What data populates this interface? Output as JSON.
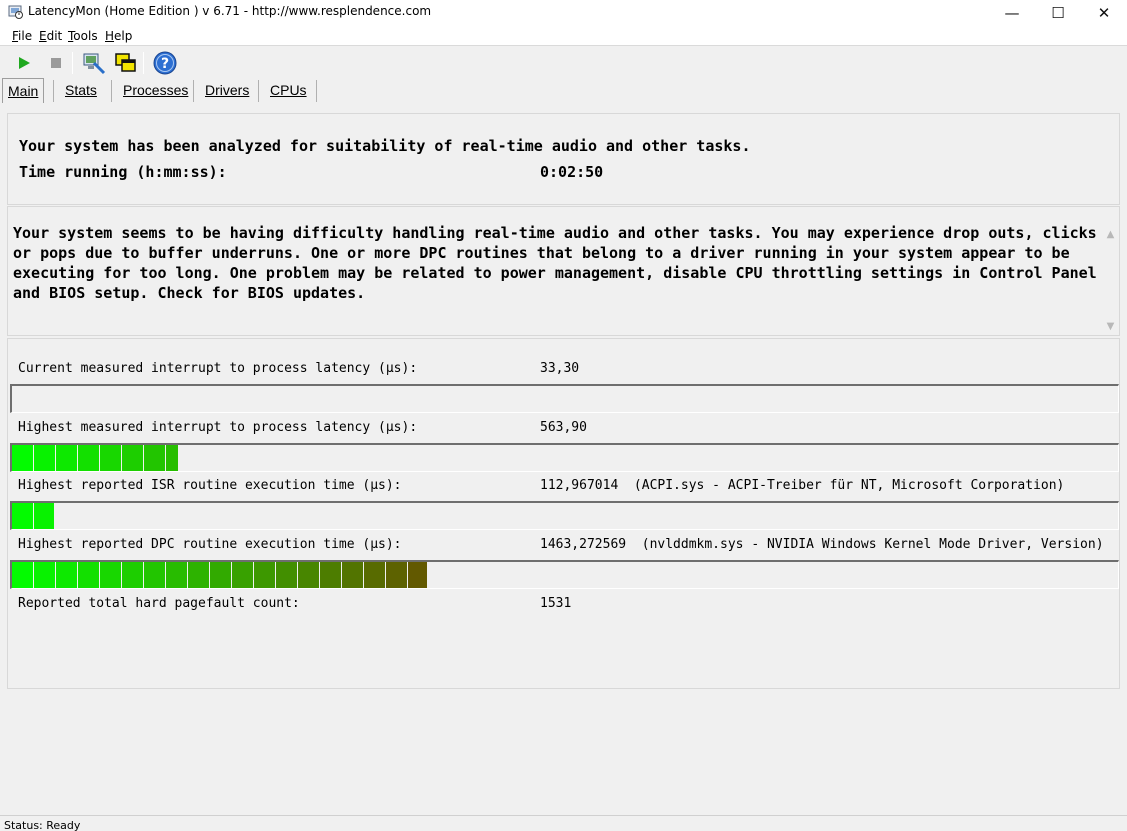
{
  "window": {
    "title": "LatencyMon  (Home Edition )  v 6.71 - http://www.resplendence.com",
    "minimize_glyph": "—",
    "maximize_glyph": "☐",
    "close_glyph": "✕"
  },
  "menu": [
    {
      "accel": "F",
      "rest": "ile"
    },
    {
      "accel": "E",
      "rest": "dit"
    },
    {
      "accel": "T",
      "rest": "ools"
    },
    {
      "accel": "H",
      "rest": "elp"
    }
  ],
  "toolbar": {
    "icons": [
      "play-icon",
      "stop-icon",
      "analyze-icon",
      "windows-icon",
      "help-icon"
    ]
  },
  "tabs": [
    "Main",
    "Stats",
    "Processes",
    "Drivers",
    "CPUs"
  ],
  "summary": {
    "line1": "Your system has been analyzed for suitability of real-time audio and other tasks.",
    "time_label": "Time running (h:mm:ss):",
    "time_value": "0:02:50"
  },
  "message": "Your system seems to be having difficulty handling real-time audio and other tasks. You may experience drop outs, clicks or pops due to buffer underruns. One or more DPC routines that belong to a driver running in your system appear to be executing for too long. One problem may be related to power management, disable CPU throttling settings in Control Panel and BIOS setup. Check for BIOS updates.",
  "metrics": [
    {
      "label": "Current measured interrupt to process latency (µs):",
      "value": "33,30",
      "bar_level": 0
    },
    {
      "label": "Highest measured interrupt to process latency (µs):",
      "value": "563,90",
      "bar_level": 0.15
    },
    {
      "label": "Highest reported ISR routine execution time (µs):",
      "value": "112,967014  (ACPI.sys - ACPI-Treiber für NT, Microsoft Corporation)",
      "bar_level": 0.038
    },
    {
      "label": "Highest reported DPC routine execution time (µs):",
      "value": "1463,272569  (nvlddmkm.sys - NVIDIA Windows Kernel Mode Driver, Version)",
      "bar_level": 0.375
    }
  ],
  "pagefault": {
    "label": "Reported total hard pagefault count:",
    "value": "1531"
  },
  "status": "Status: Ready",
  "colors": {
    "bar_start": "#00ff00",
    "bar_end": "#6b4a00"
  }
}
